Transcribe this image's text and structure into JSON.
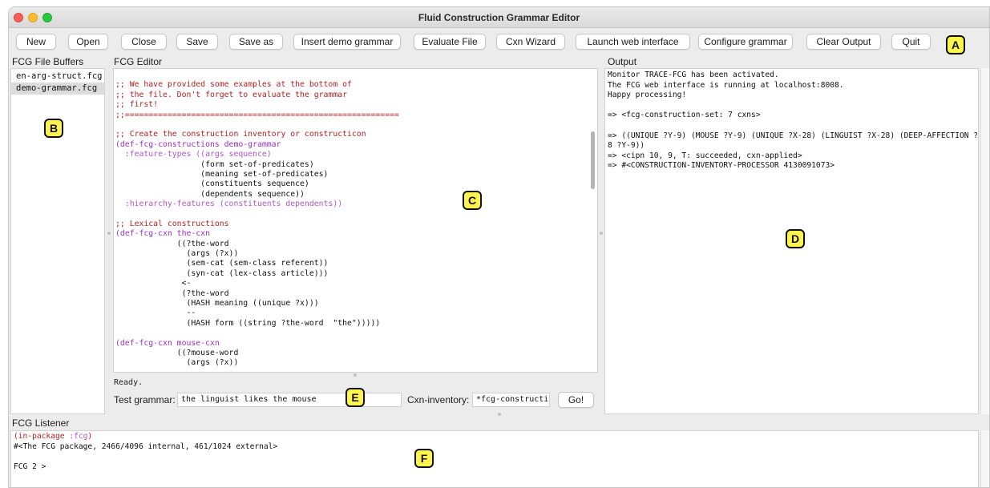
{
  "window": {
    "title": "Fluid Construction Grammar Editor"
  },
  "toolbar": {
    "new": "New",
    "open": "Open",
    "close": "Close",
    "save": "Save",
    "save_as": "Save as",
    "insert_demo": "Insert demo grammar",
    "evaluate_file": "Evaluate File",
    "cxn_wizard": "Cxn Wizard",
    "launch_web": "Launch web interface",
    "configure": "Configure grammar",
    "clear_output": "Clear Output",
    "quit": "Quit"
  },
  "buffers": {
    "label": "FCG File Buffers",
    "items": [
      "en-arg-struct.fcg",
      "demo-grammar.fcg"
    ],
    "selected": "demo-grammar.fcg"
  },
  "editor": {
    "label": "FCG Editor",
    "lines": [
      "",
      ";; We have provided some examples at the bottom of",
      ";; the file. Don't forget to evaluate the grammar",
      ";; first!",
      ";;==========================================================",
      "",
      ";; Create the construction inventory or constructicon",
      "(def-fcg-constructions demo-grammar",
      "  :feature-types ((args sequence)",
      "                  (form set-of-predicates)",
      "                  (meaning set-of-predicates)",
      "                  (constituents sequence)",
      "                  (dependents sequence))",
      "  :hierarchy-features (constituents dependents))",
      "",
      ";; Lexical constructions",
      "(def-fcg-cxn the-cxn",
      "             ((?the-word",
      "               (args (?x))",
      "               (sem-cat (sem-class referent))",
      "               (syn-cat (lex-class article)))",
      "              <-",
      "              (?the-word",
      "               (HASH meaning ((unique ?x)))",
      "               --",
      "               (HASH form ((string ?the-word  \"the\")))))",
      "",
      "(def-fcg-cxn mouse-cxn",
      "             ((?mouse-word",
      "               (args (?x))"
    ],
    "status": "Ready."
  },
  "output": {
    "label": "Output",
    "lines": [
      "Monitor TRACE-FCG has been activated.",
      "The FCG web interface is running at localhost:8008.",
      "Happy processing!",
      "",
      "=> <fcg-construction-set: 7 cxns>",
      "",
      "=> ((UNIQUE ?Y-9) (MOUSE ?Y-9) (UNIQUE ?X-28) (LINGUIST ?X-28) (DEEP-AFFECTION ?X-2 »",
      "8 ?Y-9))",
      "=> <cipn 10, 9, T: succeeded, cxn-applied>",
      "=> #<CONSTRUCTION-INVENTORY-PROCESSOR 4130091073>"
    ]
  },
  "test": {
    "label": "Test grammar:",
    "value": "the linguist likes the mouse",
    "cxn_label": "Cxn-inventory:",
    "cxn_value": "*fcg-constructic",
    "go": "Go!"
  },
  "listener": {
    "label": "FCG Listener",
    "line1_open": "(in-package ",
    "line1_kw": ":fcg",
    "line1_close": ")",
    "line2": "#<The FCG package, 2466/4096 internal, 461/1024 external>",
    "line3": "",
    "prompt": "FCG 2 >"
  },
  "annotations": [
    "A",
    "B",
    "C",
    "D",
    "E",
    "F"
  ]
}
